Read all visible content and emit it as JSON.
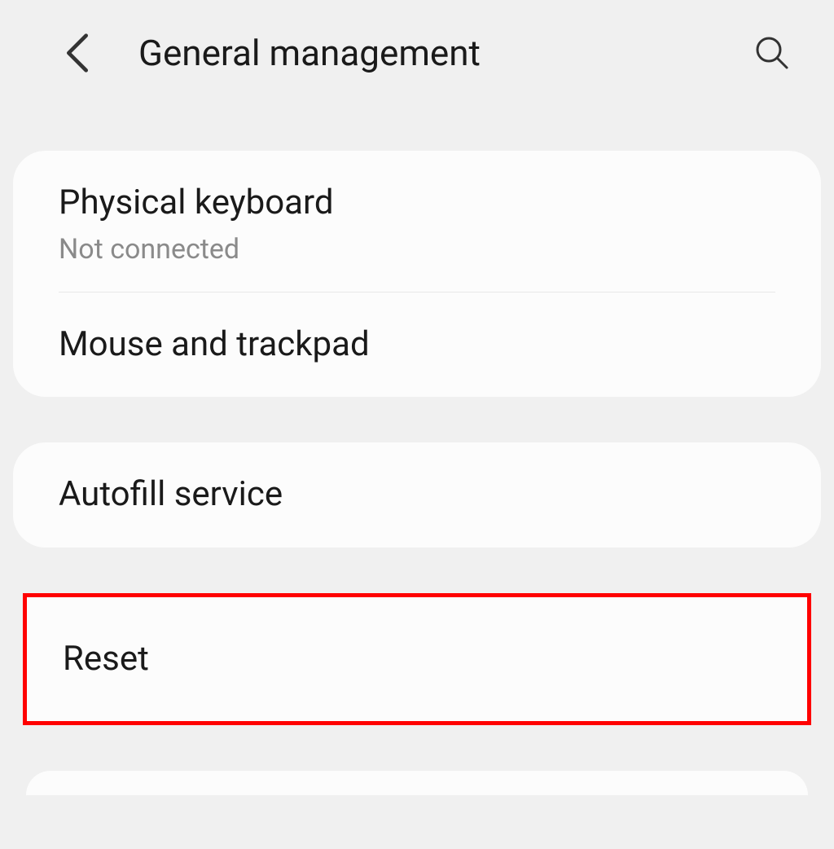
{
  "header": {
    "title": "General management"
  },
  "groups": [
    {
      "items": [
        {
          "title": "Physical keyboard",
          "subtitle": "Not connected"
        },
        {
          "title": "Mouse and trackpad"
        }
      ]
    },
    {
      "items": [
        {
          "title": "Autofill service"
        }
      ]
    },
    {
      "highlighted": true,
      "items": [
        {
          "title": "Reset"
        }
      ]
    }
  ]
}
